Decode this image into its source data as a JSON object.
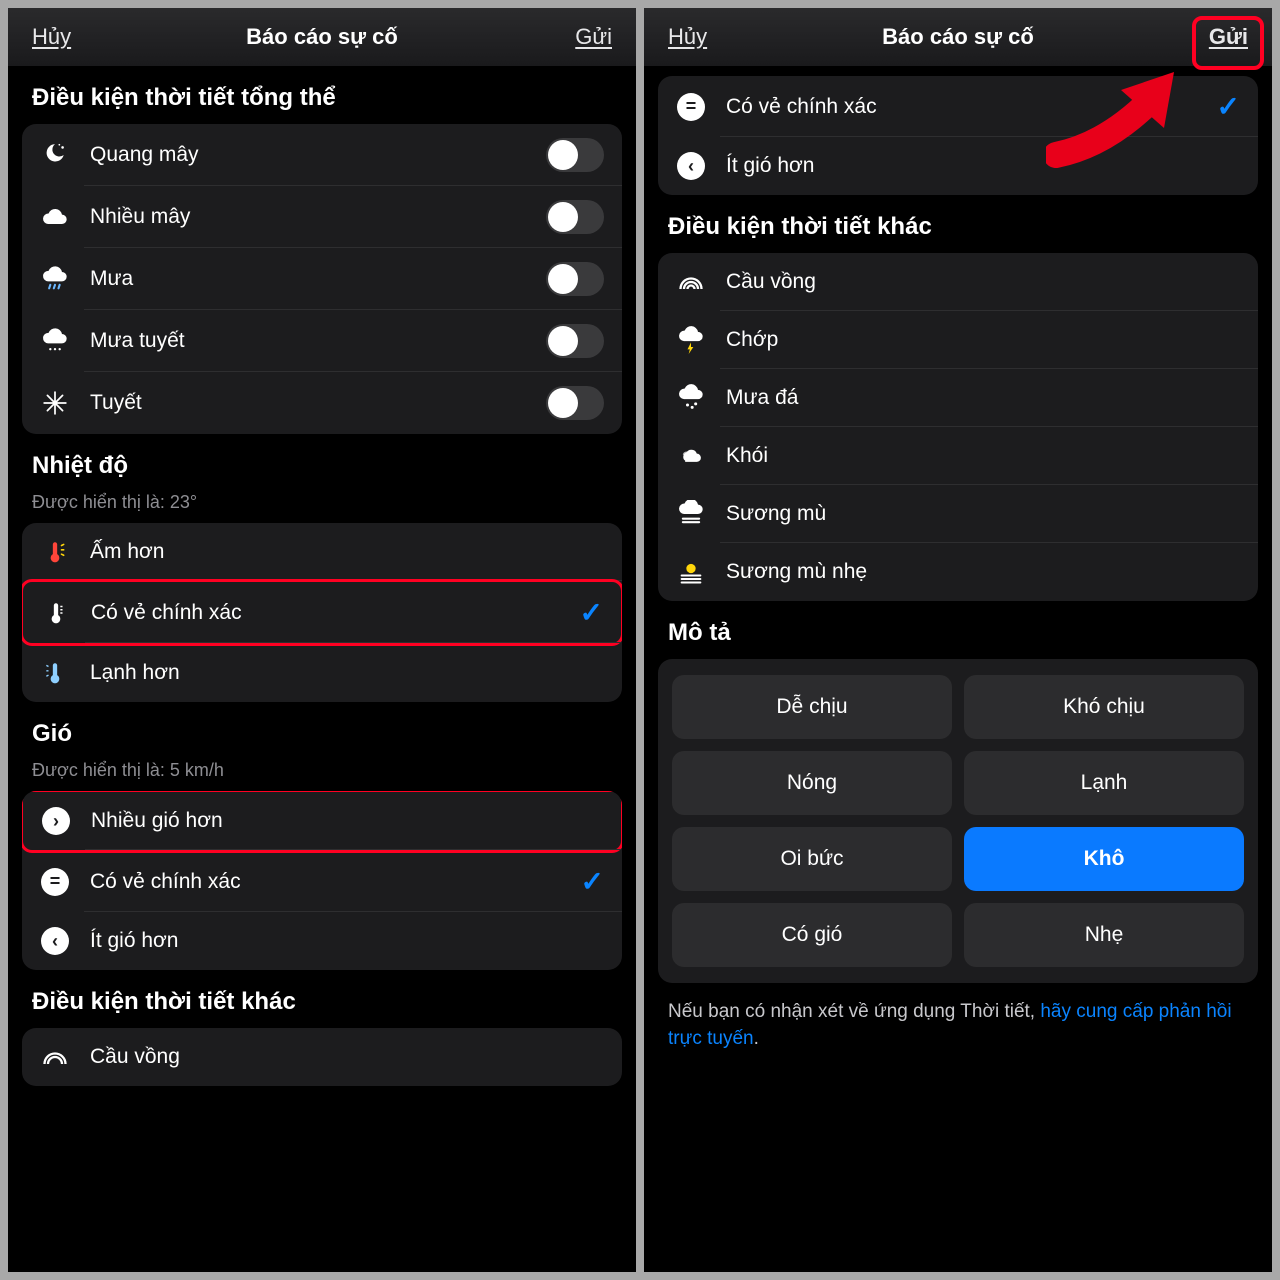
{
  "header": {
    "cancel": "Hủy",
    "title": "Báo cáo sự cố",
    "send": "Gửi"
  },
  "left": {
    "overall": {
      "title": "Điều kiện thời tiết tổng thể",
      "items": [
        {
          "label": "Quang mây"
        },
        {
          "label": "Nhiều mây"
        },
        {
          "label": "Mưa"
        },
        {
          "label": "Mưa tuyết"
        },
        {
          "label": "Tuyết"
        }
      ]
    },
    "temp": {
      "title": "Nhiệt độ",
      "subtitle": "Được hiển thị là: 23°",
      "items": [
        {
          "label": "Ấm hơn"
        },
        {
          "label": "Có vẻ chính xác"
        },
        {
          "label": "Lạnh hơn"
        }
      ]
    },
    "wind": {
      "title": "Gió",
      "subtitle": "Được hiển thị là: 5 km/h",
      "items": [
        {
          "label": "Nhiều gió hơn"
        },
        {
          "label": "Có vẻ chính xác"
        },
        {
          "label": "Ít gió hơn"
        }
      ]
    },
    "other_title": "Điều kiện thời tiết khác",
    "other_first": "Cầu vồng"
  },
  "right": {
    "wind_tail": [
      {
        "label": "Có vẻ chính xác"
      },
      {
        "label": "Ít gió hơn"
      }
    ],
    "other": {
      "title": "Điều kiện thời tiết khác",
      "items": [
        {
          "label": "Cầu vồng"
        },
        {
          "label": "Chớp"
        },
        {
          "label": "Mưa đá"
        },
        {
          "label": "Khói"
        },
        {
          "label": "Sương mù"
        },
        {
          "label": "Sương mù nhẹ"
        }
      ]
    },
    "desc": {
      "title": "Mô tả",
      "chips": [
        "Dễ chịu",
        "Khó chịu",
        "Nóng",
        "Lạnh",
        "Oi bức",
        "Khô",
        "Có gió",
        "Nhẹ"
      ],
      "selected": "Khô"
    },
    "footnote_text": "Nếu bạn có nhận xét về ứng dụng Thời tiết, ",
    "footnote_link": "hãy cung cấp phản hồi trực tuyến"
  }
}
